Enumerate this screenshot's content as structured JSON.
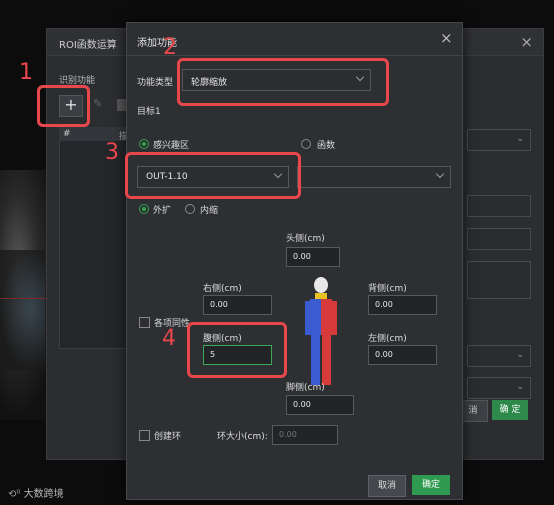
{
  "background_dialog": {
    "title": "ROI函数运算",
    "close": "×",
    "section_label": "识别功能",
    "add_button": "+",
    "table_header_index": "#",
    "table_header_col": "描",
    "cancel_label": "消",
    "ok_label": "确 定"
  },
  "dialog": {
    "title": "添加功能",
    "close": "×",
    "func_type_label": "功能类型",
    "func_type_value": "轮廓缩放",
    "target_label": "目标1",
    "radio_roi": "感兴趣区",
    "radio_function": "函数",
    "roi_select_value": "OUT-1.10",
    "radio_expand": "外扩",
    "radio_shrink": "内缩",
    "uniform_label": "各项同性",
    "head_label": "头侧(cm)",
    "head_value": "0.00",
    "right_label": "右侧(cm)",
    "right_value": "0.00",
    "back_label": "背侧(cm)",
    "back_value": "0.00",
    "ventral_label": "腹侧(cm)",
    "ventral_value": "5",
    "left_label": "左侧(cm)",
    "left_value": "0.00",
    "foot_label": "脚侧(cm)",
    "foot_value": "0.00",
    "create_ring_label": "创建环",
    "ring_size_label": "环大小(cm):",
    "ring_size_value": "0.00",
    "cancel_label": "取消",
    "ok_label": "确定"
  },
  "annotations": [
    "1",
    "2",
    "3",
    "4"
  ],
  "watermark": "大数跨境",
  "colors": {
    "accent_green": "#2e9a4f",
    "annotation_red": "#e8474b"
  }
}
